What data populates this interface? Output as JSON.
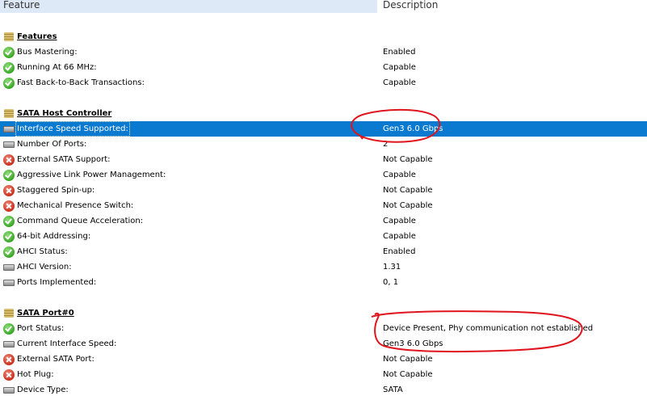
{
  "header": {
    "feature": "Feature",
    "description": "Description"
  },
  "rows": [
    {
      "type": "section",
      "icon": "section-icon",
      "feature": "Features",
      "value": ""
    },
    {
      "type": "item",
      "icon": "check-icon",
      "feature": "Bus Mastering:",
      "value": "Enabled"
    },
    {
      "type": "item",
      "icon": "check-icon",
      "feature": "Running At 66 MHz:",
      "value": "Capable"
    },
    {
      "type": "item",
      "icon": "check-icon",
      "feature": "Fast Back-to-Back Transactions:",
      "value": "Capable"
    },
    {
      "type": "blank"
    },
    {
      "type": "section",
      "icon": "section-icon",
      "feature": "SATA Host Controller",
      "value": ""
    },
    {
      "type": "item",
      "icon": "device-icon",
      "feature": "Interface Speed Supported:",
      "value": "Gen3 6.0 Gbps",
      "selected": true
    },
    {
      "type": "item",
      "icon": "device-icon",
      "feature": "Number Of Ports:",
      "value": "2"
    },
    {
      "type": "item",
      "icon": "error-icon",
      "feature": "External SATA Support:",
      "value": "Not Capable"
    },
    {
      "type": "item",
      "icon": "check-icon",
      "feature": "Aggressive Link Power Management:",
      "value": "Capable"
    },
    {
      "type": "item",
      "icon": "error-icon",
      "feature": "Staggered Spin-up:",
      "value": "Not Capable"
    },
    {
      "type": "item",
      "icon": "error-icon",
      "feature": "Mechanical Presence Switch:",
      "value": "Not Capable"
    },
    {
      "type": "item",
      "icon": "check-icon",
      "feature": "Command Queue Acceleration:",
      "value": "Capable"
    },
    {
      "type": "item",
      "icon": "check-icon",
      "feature": "64-bit Addressing:",
      "value": "Capable"
    },
    {
      "type": "item",
      "icon": "check-icon",
      "feature": "AHCI Status:",
      "value": "Enabled"
    },
    {
      "type": "item",
      "icon": "device-icon",
      "feature": "AHCI Version:",
      "value": "1.31"
    },
    {
      "type": "item",
      "icon": "device-icon",
      "feature": "Ports Implemented:",
      "value": "0, 1"
    },
    {
      "type": "blank"
    },
    {
      "type": "section",
      "icon": "section-icon",
      "feature": "SATA Port#0",
      "value": ""
    },
    {
      "type": "item",
      "icon": "check-icon",
      "feature": "Port Status:",
      "value": "Device Present, Phy communication not established"
    },
    {
      "type": "item",
      "icon": "device-icon",
      "feature": "Current Interface Speed:",
      "value": "Gen3 6.0 Gbps"
    },
    {
      "type": "item",
      "icon": "error-icon",
      "feature": "External SATA Port:",
      "value": "Not Capable"
    },
    {
      "type": "item",
      "icon": "error-icon",
      "feature": "Hot Plug:",
      "value": "Not Capable"
    },
    {
      "type": "item",
      "icon": "device-icon",
      "feature": "Device Type:",
      "value": "SATA"
    }
  ],
  "colors": {
    "selection": "#0a7ad0",
    "header_bg": "#dde9f6",
    "annotation": "#e0141c"
  }
}
